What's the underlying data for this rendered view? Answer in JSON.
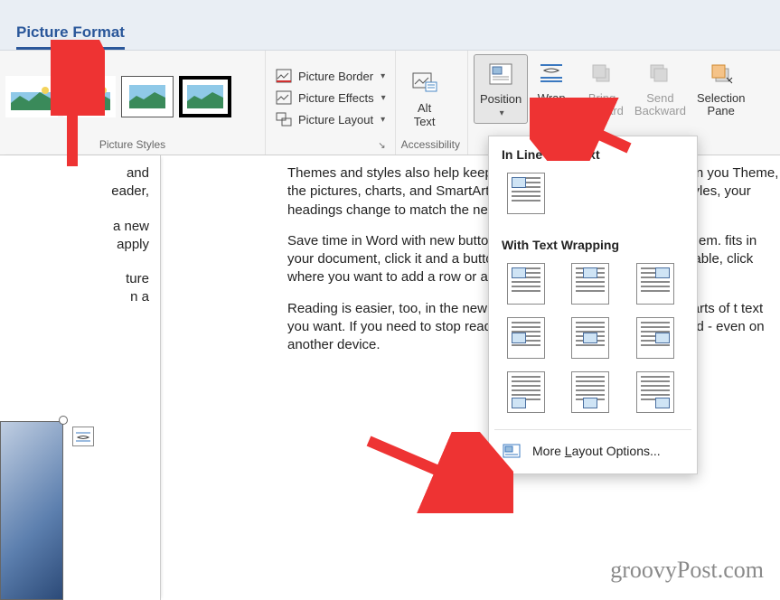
{
  "tab": {
    "label": "Picture Format"
  },
  "ribbon": {
    "groups": {
      "picture_styles": {
        "label": "Picture Styles"
      },
      "accessibility": {
        "label": "Accessibility",
        "launcher_glyph": "↘"
      },
      "arrange": {
        "label": ""
      }
    },
    "buttons": {
      "picture_border": "Picture Border",
      "picture_effects": "Picture Effects",
      "picture_layout": "Picture Layout",
      "alt_text": "Alt\nText",
      "position": "Position",
      "wrap_text": "Wrap\nText",
      "bring_forward": "Bring\nForward",
      "send_backward": "Send\nBackward",
      "selection_pane": "Selection\nPane"
    }
  },
  "dropdown": {
    "section_inline": "In Line with Text",
    "section_wrap": "With Text Wrapping",
    "more_options_prefix": "More ",
    "more_options_underline": "L",
    "more_options_suffix": "ayout Options..."
  },
  "doc": {
    "left": {
      "p1": "and\neader,",
      "p2": "a new\napply",
      "p3": "ture\nn a"
    },
    "right": {
      "p1": "Themes and styles also help keep your document coordinated. When you Theme, the pictures, charts, and SmartArt graphics change to match your styles, your headings change to match the new theme.",
      "p2": "Save time in Word with new buttons that show up where you need them. fits in your document, click it and a button for layout options appears nex table, click where you want to add a row or a column, and then click the p",
      "p3": "Reading is easier, too, in the new Reading view. You can collapse parts of t text you want. If you need to stop reading before you reach the end, Word - even on another device."
    }
  },
  "watermark": "groovyPost.com"
}
